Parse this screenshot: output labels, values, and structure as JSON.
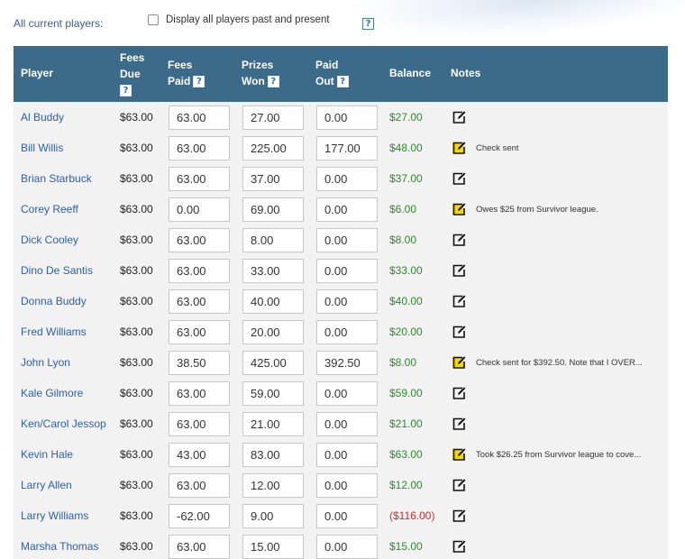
{
  "filter": {
    "all_current_label": "All current players:",
    "display_all_label": "Display all players past and present",
    "help_glyph": "?"
  },
  "columns": {
    "player": "Player",
    "fees_due_1": "Fees",
    "fees_due_2": "Due",
    "fees_paid_1": "Fees",
    "fees_paid_2": "Paid",
    "prizes_won_1": "Prizes",
    "prizes_won_2": "Won",
    "paid_out_1": "Paid",
    "paid_out_2": "Out",
    "balance": "Balance",
    "notes": "Notes"
  },
  "colors": {
    "header_bg": "#3c6b8a",
    "player_link": "#2d5fae",
    "balance_positive": "#2e8a2e",
    "balance_negative": "#d12b2b",
    "note_highlight": "#f5d800"
  },
  "rows": [
    {
      "name": "Al Buddy",
      "fees_due": "$63.00",
      "fees_paid": "63.00",
      "prizes_won": "27.00",
      "paid_out": "0.00",
      "balance": "$27.00",
      "negative": false,
      "note_icon": "edit-note-icon",
      "note": ""
    },
    {
      "name": "Bill Willis",
      "fees_due": "$63.00",
      "fees_paid": "63.00",
      "prizes_won": "225.00",
      "paid_out": "177.00",
      "balance": "$48.00",
      "negative": false,
      "note_icon": "edit-note-filled-icon",
      "note": "Check sent"
    },
    {
      "name": "Brian Starbuck",
      "fees_due": "$63.00",
      "fees_paid": "63.00",
      "prizes_won": "37.00",
      "paid_out": "0.00",
      "balance": "$37.00",
      "negative": false,
      "note_icon": "edit-note-icon",
      "note": ""
    },
    {
      "name": "Corey Reeff",
      "fees_due": "$63.00",
      "fees_paid": "0.00",
      "prizes_won": "69.00",
      "paid_out": "0.00",
      "balance": "$6.00",
      "negative": false,
      "note_icon": "edit-note-filled-icon",
      "note": "Owes $25 from Survivor league."
    },
    {
      "name": "Dick Cooley",
      "fees_due": "$63.00",
      "fees_paid": "63.00",
      "prizes_won": "8.00",
      "paid_out": "0.00",
      "balance": "$8.00",
      "negative": false,
      "note_icon": "edit-note-icon",
      "note": ""
    },
    {
      "name": "Dino De Santis",
      "fees_due": "$63.00",
      "fees_paid": "63.00",
      "prizes_won": "33.00",
      "paid_out": "0.00",
      "balance": "$33.00",
      "negative": false,
      "note_icon": "edit-note-icon",
      "note": ""
    },
    {
      "name": "Donna Buddy",
      "fees_due": "$63.00",
      "fees_paid": "63.00",
      "prizes_won": "40.00",
      "paid_out": "0.00",
      "balance": "$40.00",
      "negative": false,
      "note_icon": "edit-note-icon",
      "note": ""
    },
    {
      "name": "Fred Williams",
      "fees_due": "$63.00",
      "fees_paid": "63.00",
      "prizes_won": "20.00",
      "paid_out": "0.00",
      "balance": "$20.00",
      "negative": false,
      "note_icon": "edit-note-icon",
      "note": ""
    },
    {
      "name": "John Lyon",
      "fees_due": "$63.00",
      "fees_paid": "38.50",
      "prizes_won": "425.00",
      "paid_out": "392.50",
      "balance": "$8.00",
      "negative": false,
      "note_icon": "edit-note-filled-icon",
      "note": "Check sent for $392.50. Note that I OVER..."
    },
    {
      "name": "Kale Gilmore",
      "fees_due": "$63.00",
      "fees_paid": "63.00",
      "prizes_won": "59.00",
      "paid_out": "0.00",
      "balance": "$59.00",
      "negative": false,
      "note_icon": "edit-note-icon",
      "note": ""
    },
    {
      "name": "Ken/Carol Jessop",
      "fees_due": "$63.00",
      "fees_paid": "63.00",
      "prizes_won": "21.00",
      "paid_out": "0.00",
      "balance": "$21.00",
      "negative": false,
      "note_icon": "edit-note-icon",
      "note": ""
    },
    {
      "name": "Kevin Hale",
      "fees_due": "$63.00",
      "fees_paid": "43.00",
      "prizes_won": "83.00",
      "paid_out": "0.00",
      "balance": "$63.00",
      "negative": false,
      "note_icon": "edit-note-filled-icon",
      "note": "Took $26.25 from Survivor league to cove..."
    },
    {
      "name": "Larry Allen",
      "fees_due": "$63.00",
      "fees_paid": "63.00",
      "prizes_won": "12.00",
      "paid_out": "0.00",
      "balance": "$12.00",
      "negative": false,
      "note_icon": "edit-note-icon",
      "note": ""
    },
    {
      "name": "Larry Williams",
      "fees_due": "$63.00",
      "fees_paid": "-62.00",
      "prizes_won": "9.00",
      "paid_out": "0.00",
      "balance": "($116.00)",
      "negative": true,
      "note_icon": "edit-note-icon",
      "note": ""
    },
    {
      "name": "Marsha Thomas",
      "fees_due": "$63.00",
      "fees_paid": "63.00",
      "prizes_won": "15.00",
      "paid_out": "0.00",
      "balance": "$15.00",
      "negative": false,
      "note_icon": "edit-note-icon",
      "note": ""
    }
  ]
}
